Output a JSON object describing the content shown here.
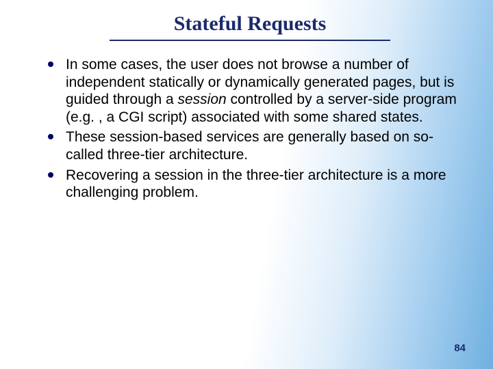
{
  "title": "Stateful Requests",
  "bullets": [
    {
      "pre": "In some cases, the user does not browse a number of independent statically or dynamically generated pages, but is guided through a ",
      "em": "session",
      "post": " controlled by a server-side program (e.g. , a CGI script) associated with some shared states."
    },
    {
      "pre": "These session-based services are generally based on so-called three-tier architecture.",
      "em": "",
      "post": ""
    },
    {
      "pre": "Recovering a session in the three-tier architecture is a more challenging problem.",
      "em": "",
      "post": ""
    }
  ],
  "page_number": "84"
}
